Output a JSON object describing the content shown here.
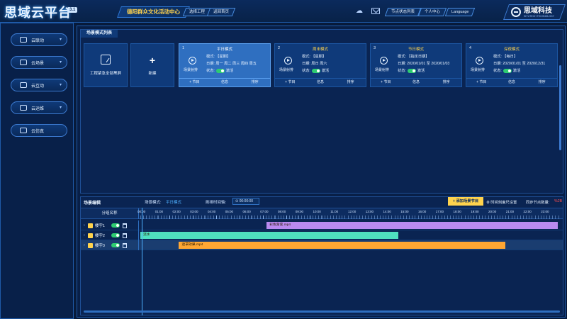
{
  "header": {
    "brand": "思域云平台",
    "version": "3.1",
    "venue": "德阳群众文化活动中心",
    "select_project": "选择工程",
    "back_home": "返回首页",
    "node_status": "节点状态列表",
    "personal_center": "个人中心",
    "language": "Language",
    "logo_cn": "思域科技",
    "logo_en": "SIYUTECH TECHNOLOGY"
  },
  "sidebar": {
    "items": [
      {
        "label": "云联动"
      },
      {
        "label": "云场景"
      },
      {
        "label": "云互动"
      },
      {
        "label": "云运维"
      },
      {
        "label": "云仿真"
      }
    ]
  },
  "scene_panel": {
    "title": "场景模式列表",
    "emergency_label": "工程紧急全部黑屏",
    "new_label": "新建",
    "play_label": "场景射排",
    "mode_key": "模式:",
    "date_key": "日期:",
    "status_key": "状态:",
    "status_value": "激活",
    "action_program": "+ 节目",
    "action_info": "信息",
    "action_sort": "排序",
    "cards": [
      {
        "num": "1",
        "name": "平日模式",
        "mode": "【星期】",
        "date": "周一 周二 周三 周四 周五"
      },
      {
        "num": "2",
        "name": "周末模式",
        "mode": "【星期】",
        "date": "周日 周六"
      },
      {
        "num": "3",
        "name": "节日模式",
        "mode": "【指定日期】",
        "date": "2020/01/01 至 2020/01/03"
      },
      {
        "num": "4",
        "name": "深夜模式",
        "mode": "【每日】",
        "date": "2020/01/01 至 2020/12/31"
      }
    ]
  },
  "editor": {
    "title": "场景编辑",
    "scene_mode_label": "场景模式:",
    "scene_mode_value": "平日模式",
    "refresh_label": "刷排时间轴:",
    "time_value": "00:00:00",
    "add_scene_button": "+ 添加场景节目",
    "grid_setting": "时间刻度尺设置",
    "sync_label": "同步节点数量:",
    "sync_value": "%2B",
    "group_header": "分组名称",
    "ticks": [
      "00:00",
      "01:00",
      "02:00",
      "03:00",
      "04:00",
      "05:00",
      "06:00",
      "07:00",
      "08:00",
      "09:00",
      "10:00",
      "11:00",
      "12:00",
      "13:00",
      "14:00",
      "15:00",
      "16:00",
      "17:00",
      "18:00",
      "19:00",
      "20:00",
      "21:00",
      "22:00",
      "23:00"
    ],
    "rows": [
      {
        "name": "楼宇1",
        "clip": "彩色渐变.mp4",
        "color": "#b98af0",
        "start_h": 7.2,
        "end_h": 23.8
      },
      {
        "name": "楼宇2",
        "clip": "流水",
        "color": "#4fe0c0",
        "start_h": 0.0,
        "end_h": 14.7
      },
      {
        "name": "楼宇3",
        "clip": "遮罩效果.mp4",
        "color": "#ffa733",
        "start_h": 2.2,
        "end_h": 20.8
      }
    ]
  }
}
